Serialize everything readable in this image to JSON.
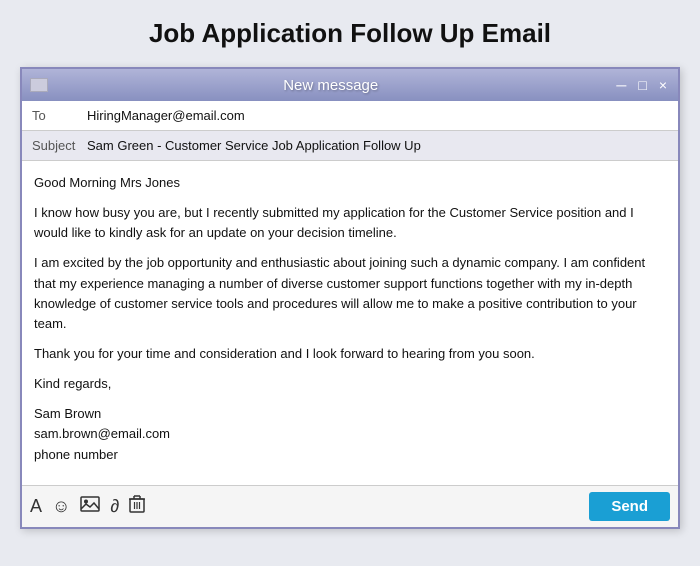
{
  "page": {
    "title": "Job Application Follow Up Email"
  },
  "window": {
    "title": "New message",
    "to_label": "To",
    "to_value": "HiringManager@email.com",
    "subject_label": "Subject",
    "subject_value": "Sam Green - Customer Service Job Application Follow Up",
    "body_paragraphs": [
      "Good Morning Mrs Jones",
      "I know how busy you are, but I recently submitted my application for the Customer Service position and I would like to kindly ask for an update on your decision timeline.",
      "I am excited by the job opportunity and enthusiastic about joining such a dynamic company. I am confident that my experience managing a number of diverse customer support functions together with my in-depth knowledge of customer service tools and procedures will allow me to make a positive contribution to your team.",
      "Thank you for your time and consideration and I look forward to hearing from you soon.",
      "Kind regards,",
      "Sam Brown\nsam.brown@email.com\nphone number"
    ],
    "send_label": "Send"
  },
  "toolbar": {
    "icons": [
      "A",
      "☺",
      "🖼",
      "0",
      "🗑"
    ]
  },
  "controls": {
    "minimize": "─",
    "maximize": "□",
    "close": "×"
  }
}
